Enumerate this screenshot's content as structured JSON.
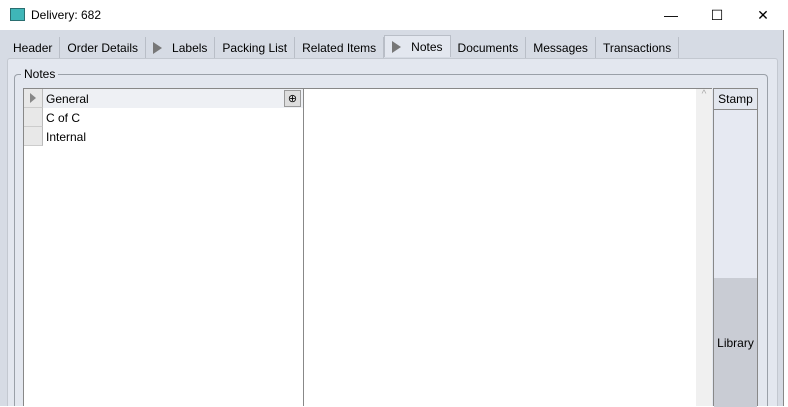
{
  "window": {
    "title": "Delivery: 682",
    "minimize": "—",
    "maximize": "☐",
    "close": "✕"
  },
  "tabs": [
    {
      "label": "Header",
      "arrow": false
    },
    {
      "label": "Order Details",
      "arrow": false
    },
    {
      "label": "Labels",
      "arrow": true
    },
    {
      "label": "Packing List",
      "arrow": false
    },
    {
      "label": "Related Items",
      "arrow": false
    },
    {
      "label": "Notes",
      "arrow": true,
      "active": true
    },
    {
      "label": "Documents",
      "arrow": false
    },
    {
      "label": "Messages",
      "arrow": false
    },
    {
      "label": "Transactions",
      "arrow": false
    }
  ],
  "notes": {
    "group_label": "Notes",
    "categories": [
      "General",
      "C of C",
      "Internal"
    ],
    "stamp_label": "Stamp",
    "library_label": "Library",
    "scroll_up": "^"
  }
}
